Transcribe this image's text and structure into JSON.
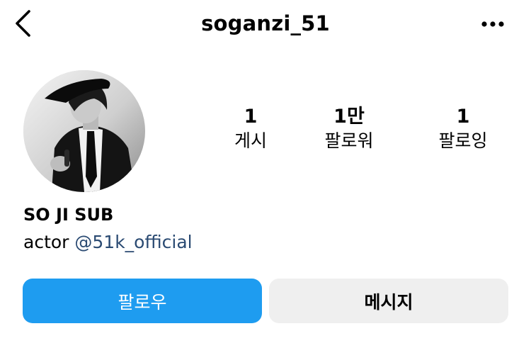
{
  "header": {
    "username": "soganzi_51",
    "back_icon": "chevron-left-icon",
    "more_icon": "more-horizontal-icon"
  },
  "profile": {
    "avatar_description": "black-and-white photo of a man wearing a hat and tie",
    "display_name": "SO JI SUB",
    "bio_prefix": "actor ",
    "bio_mention": "@51k_official",
    "mention_color": "#2a4a72"
  },
  "stats": {
    "posts": {
      "value": "1",
      "label": "게시"
    },
    "followers": {
      "value": "1만",
      "label": "팔로워"
    },
    "following": {
      "value": "1",
      "label": "팔로잉"
    }
  },
  "actions": {
    "follow_label": "팔로우",
    "message_label": "메시지",
    "follow_color": "#1e9cf0",
    "message_color": "#efefef"
  }
}
